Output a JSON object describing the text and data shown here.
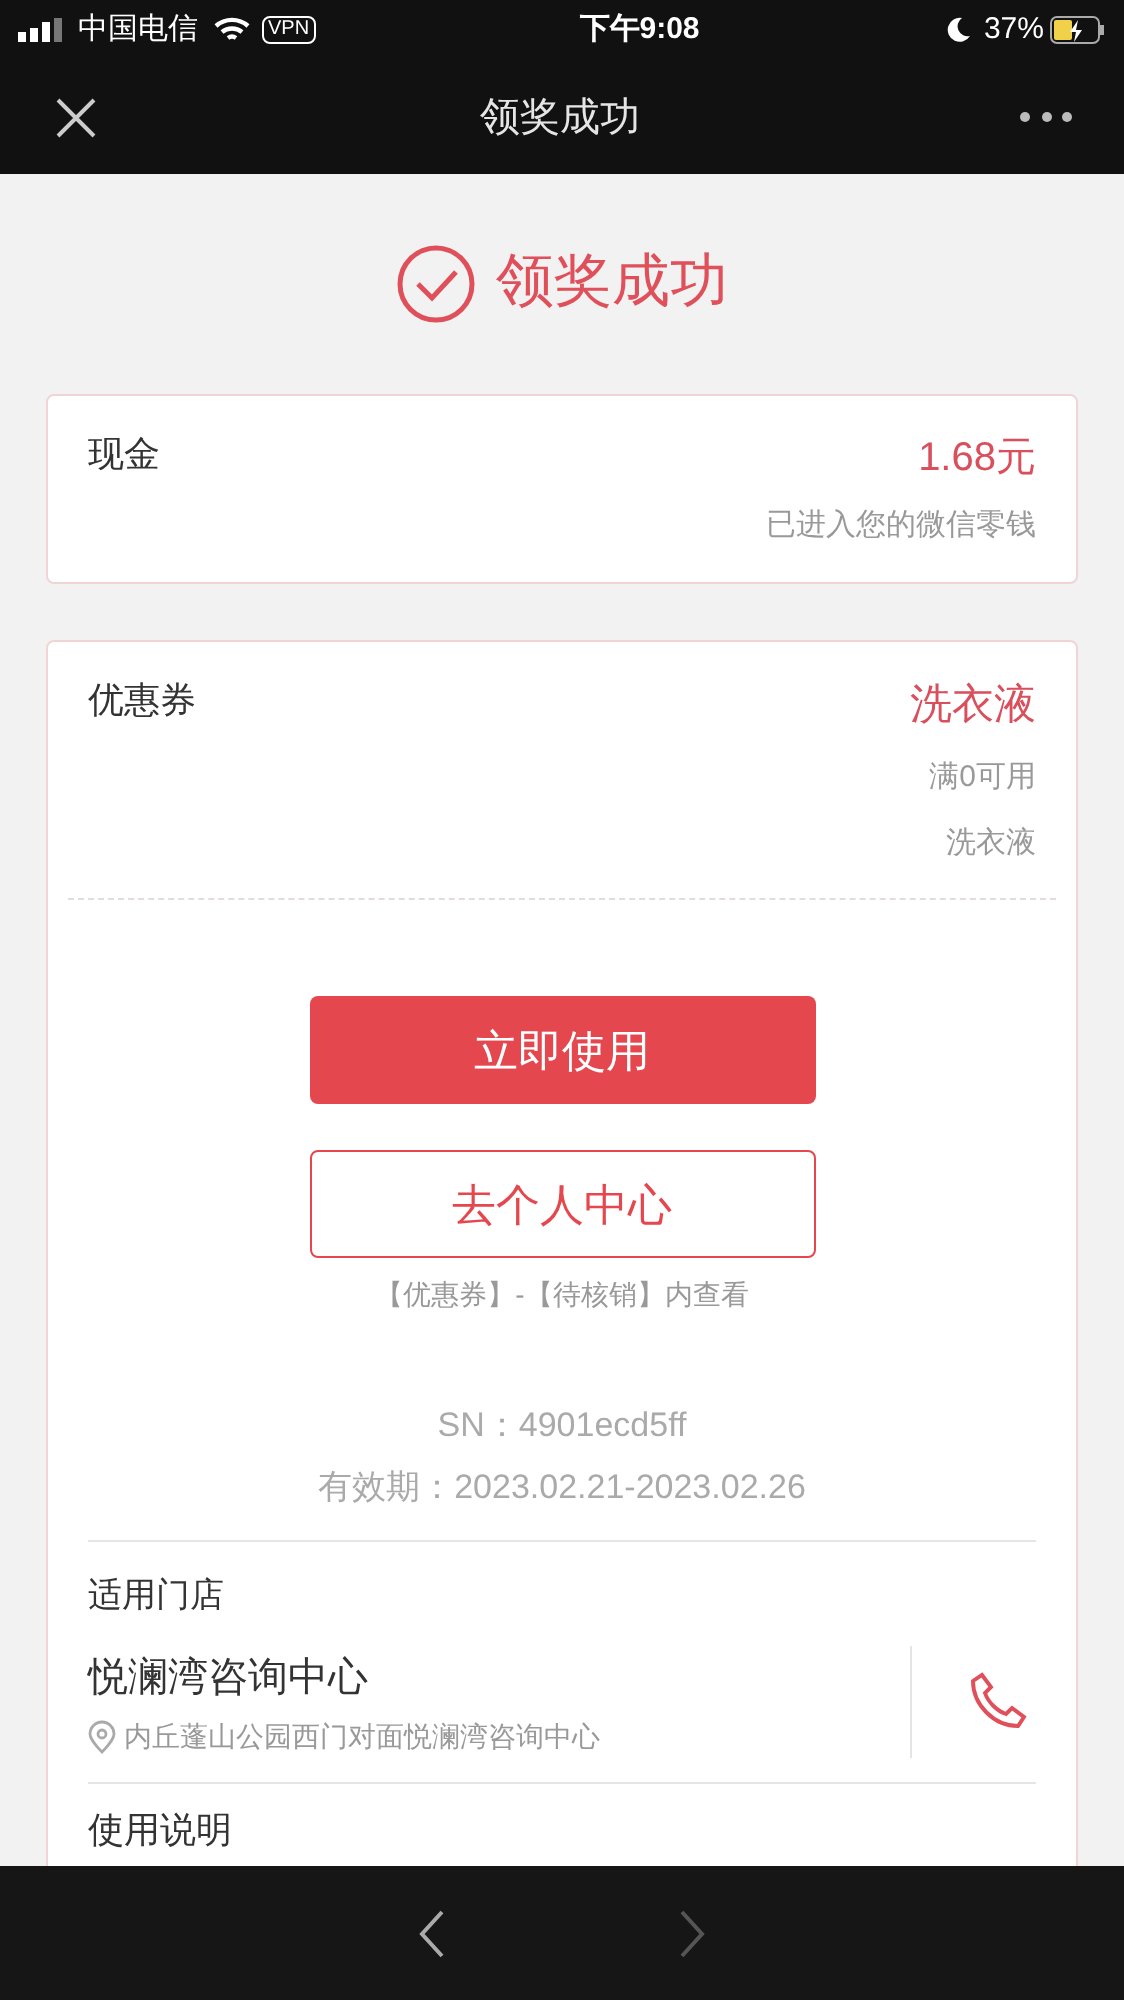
{
  "status_bar": {
    "carrier": "中国电信",
    "vpn": "VPN",
    "time": "下午9:08",
    "battery": "37%"
  },
  "nav": {
    "title": "领奖成功"
  },
  "success": {
    "title": "领奖成功"
  },
  "cash": {
    "label": "现金",
    "amount": "1.68元",
    "note": "已进入您的微信零钱"
  },
  "coupon": {
    "label": "优惠券",
    "name": "洗衣液",
    "condition": "满0可用",
    "desc": "洗衣液",
    "use_button": "立即使用",
    "center_button": "去个人中心",
    "hint": "【优惠券】-【待核销】内查看",
    "sn": "SN：4901ecd5ff",
    "validity": "有效期：2023.02.21-2023.02.26",
    "stores_label": "适用门店",
    "store_name": "悦澜湾咨询中心",
    "store_address": "内丘蓬山公园西门对面悦澜湾咨询中心",
    "instructions_label": "使用说明"
  }
}
